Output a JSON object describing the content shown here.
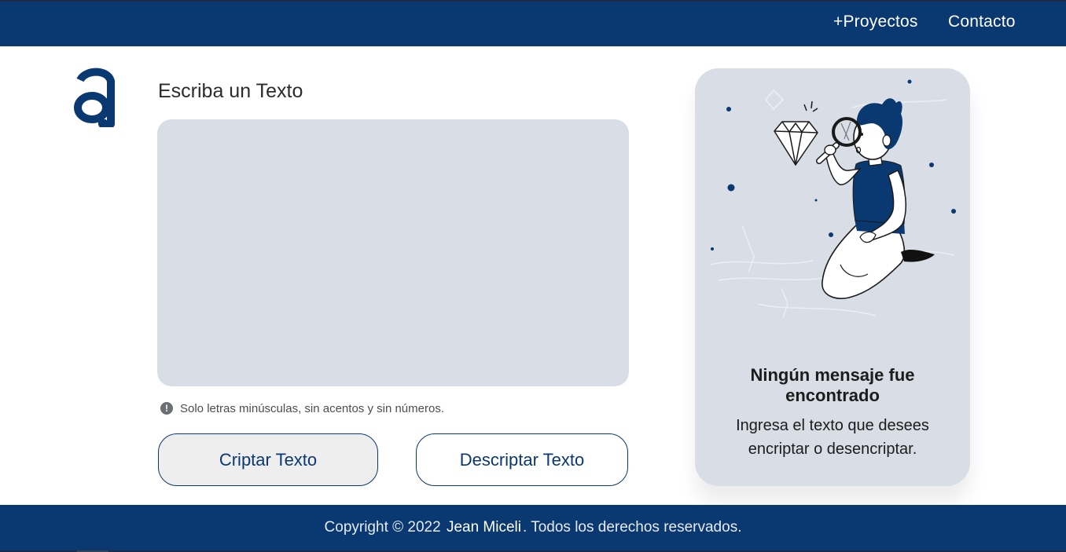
{
  "nav": {
    "projects_label": "+Proyectos",
    "contact_label": "Contacto"
  },
  "logo": {
    "icon": "alura-logo-icon",
    "color": "#0a3871"
  },
  "input": {
    "title": "Escriba un Texto",
    "value": "",
    "placeholder": "",
    "hint_icon": "exclamation-circle-icon",
    "hint": "Solo letras minúsculas, sin acentos y sin números."
  },
  "buttons": {
    "encrypt_label": "Criptar Texto",
    "decrypt_label": "Descriptar Texto"
  },
  "result": {
    "illustration": "person-with-magnifying-glass-and-diamond",
    "title": "Ningún mensaje fue encontrado",
    "subtitle": "Ingresa el texto que desees encriptar o desencriptar."
  },
  "footer": {
    "prefix": "Copyright © 2022 ",
    "author": "Jean Miceli",
    "suffix": ". Todos los derechos reservados."
  },
  "colors": {
    "primary": "#0a3871",
    "panel": "#d8dde6",
    "button_alt_bg": "#eeeeef"
  }
}
